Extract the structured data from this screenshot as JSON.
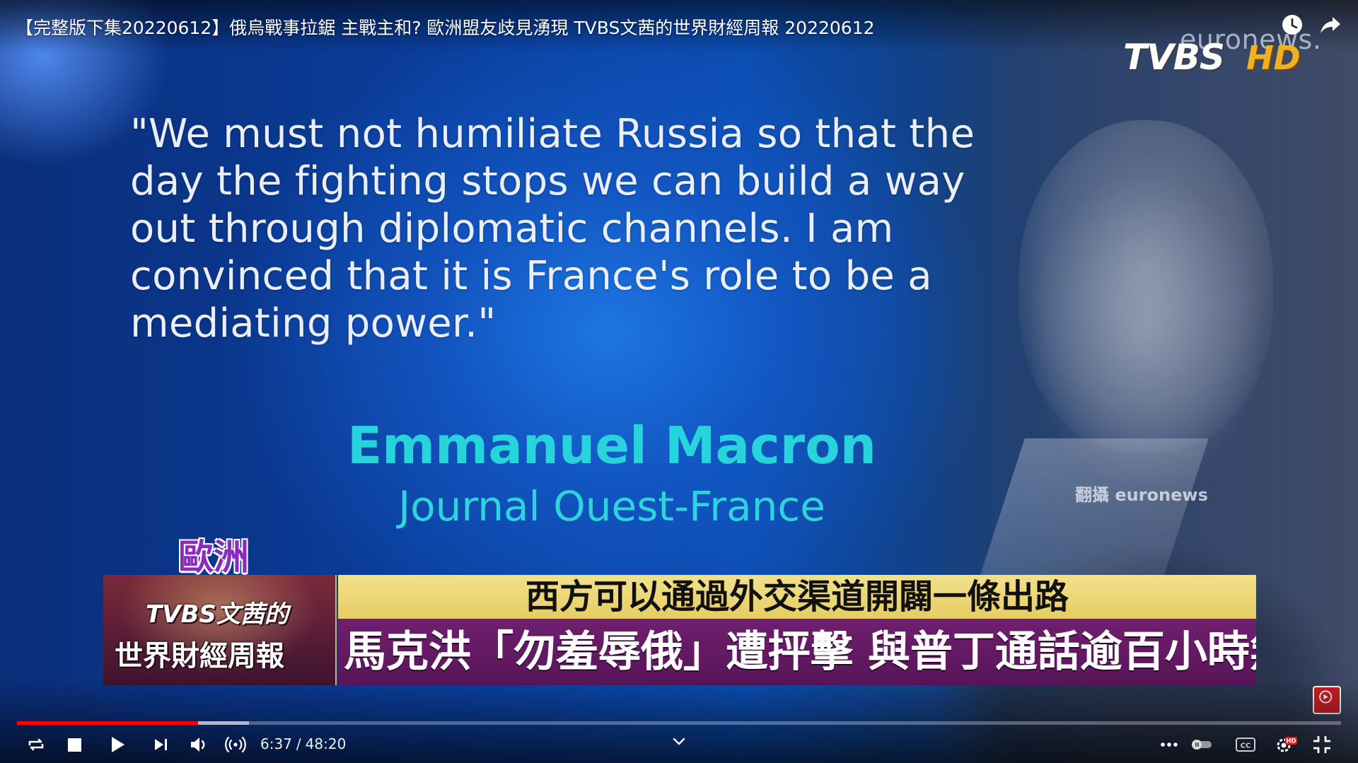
{
  "video": {
    "title": "【完整版下集20220612】俄烏戰事拉鋸 主戰主和? 歐洲盟友歧見湧現 TVBS文茜的世界財經周報 20220612"
  },
  "logos": {
    "euronews": "euronews.",
    "tvbs": "TVBS",
    "hd": "HD"
  },
  "quote": {
    "text": "\"We must not humiliate Russia so that the day the fighting stops we can build a way out through diplomatic channels. I am convinced that it is France's role to be a mediating power.\"",
    "speaker": "Emmanuel Macron",
    "source": "Journal Ouest-France"
  },
  "credit": "翻攝 euronews",
  "lower_third": {
    "region": "歐洲",
    "program_line1": "TVBS文茜的",
    "program_line2": "世界財經周報",
    "headline_top": "西方可以通過外交渠道開闢一條出路",
    "headline_main": "馬克洪「勿羞辱俄」遭抨擊 與普丁通話逾百小時無功而返"
  },
  "player": {
    "current_time": "6:37",
    "separator": "/",
    "duration": "48:20",
    "played_fraction": 0.137,
    "buffered_fraction": 0.175,
    "hd_badge": "HD",
    "cc_label": "CC"
  },
  "colors": {
    "accent_red": "#ff0000",
    "speaker_cyan": "#27d4db",
    "headline_yellow": "#e6cd63",
    "headline_purple": "#581558",
    "hd_gold": "#f0b11f"
  }
}
